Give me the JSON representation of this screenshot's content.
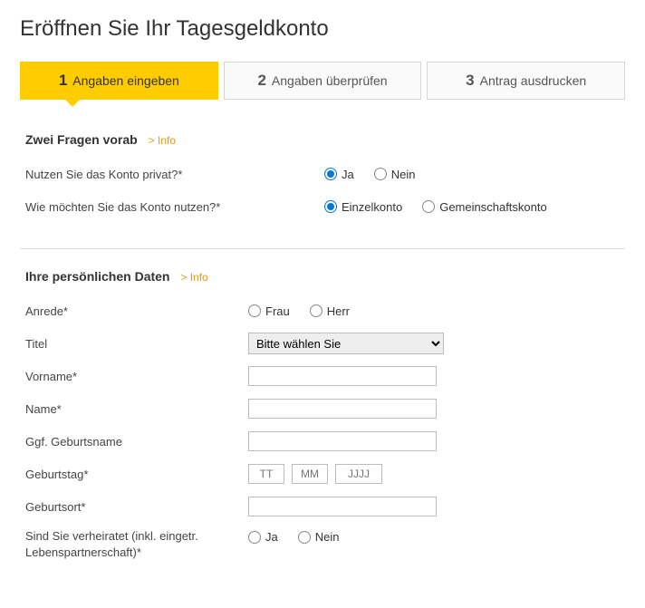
{
  "page_title": "Eröffnen Sie Ihr Tagesgeldkonto",
  "steps": [
    {
      "num": "1",
      "label": "Angaben eingeben"
    },
    {
      "num": "2",
      "label": "Angaben überprüfen"
    },
    {
      "num": "3",
      "label": "Antrag ausdrucken"
    }
  ],
  "section1": {
    "title": "Zwei Fragen vorab",
    "info": "Info",
    "q1": {
      "label": "Nutzen Sie das Konto privat?*",
      "ja": "Ja",
      "nein": "Nein"
    },
    "q2": {
      "label": "Wie möchten Sie das Konto nutzen?*",
      "einzel": "Einzelkonto",
      "gemein": "Gemeinschaftskonto"
    }
  },
  "section2": {
    "title": "Ihre persönlichen Daten",
    "info": "Info",
    "anrede": {
      "label": "Anrede*",
      "frau": "Frau",
      "herr": "Herr"
    },
    "titel": {
      "label": "Titel",
      "placeholder": "Bitte wählen Sie"
    },
    "vorname": "Vorname*",
    "name": "Name*",
    "geburtsname": "Ggf. Geburtsname",
    "geburtstag": {
      "label": "Geburtstag*",
      "tt": "TT",
      "mm": "MM",
      "jjjj": "JJJJ"
    },
    "geburtsort": "Geburtsort*",
    "verheiratet": {
      "label": "Sind Sie verheiratet (inkl. eingetr. Lebenspartnerschaft)*",
      "ja": "Ja",
      "nein": "Nein"
    }
  }
}
